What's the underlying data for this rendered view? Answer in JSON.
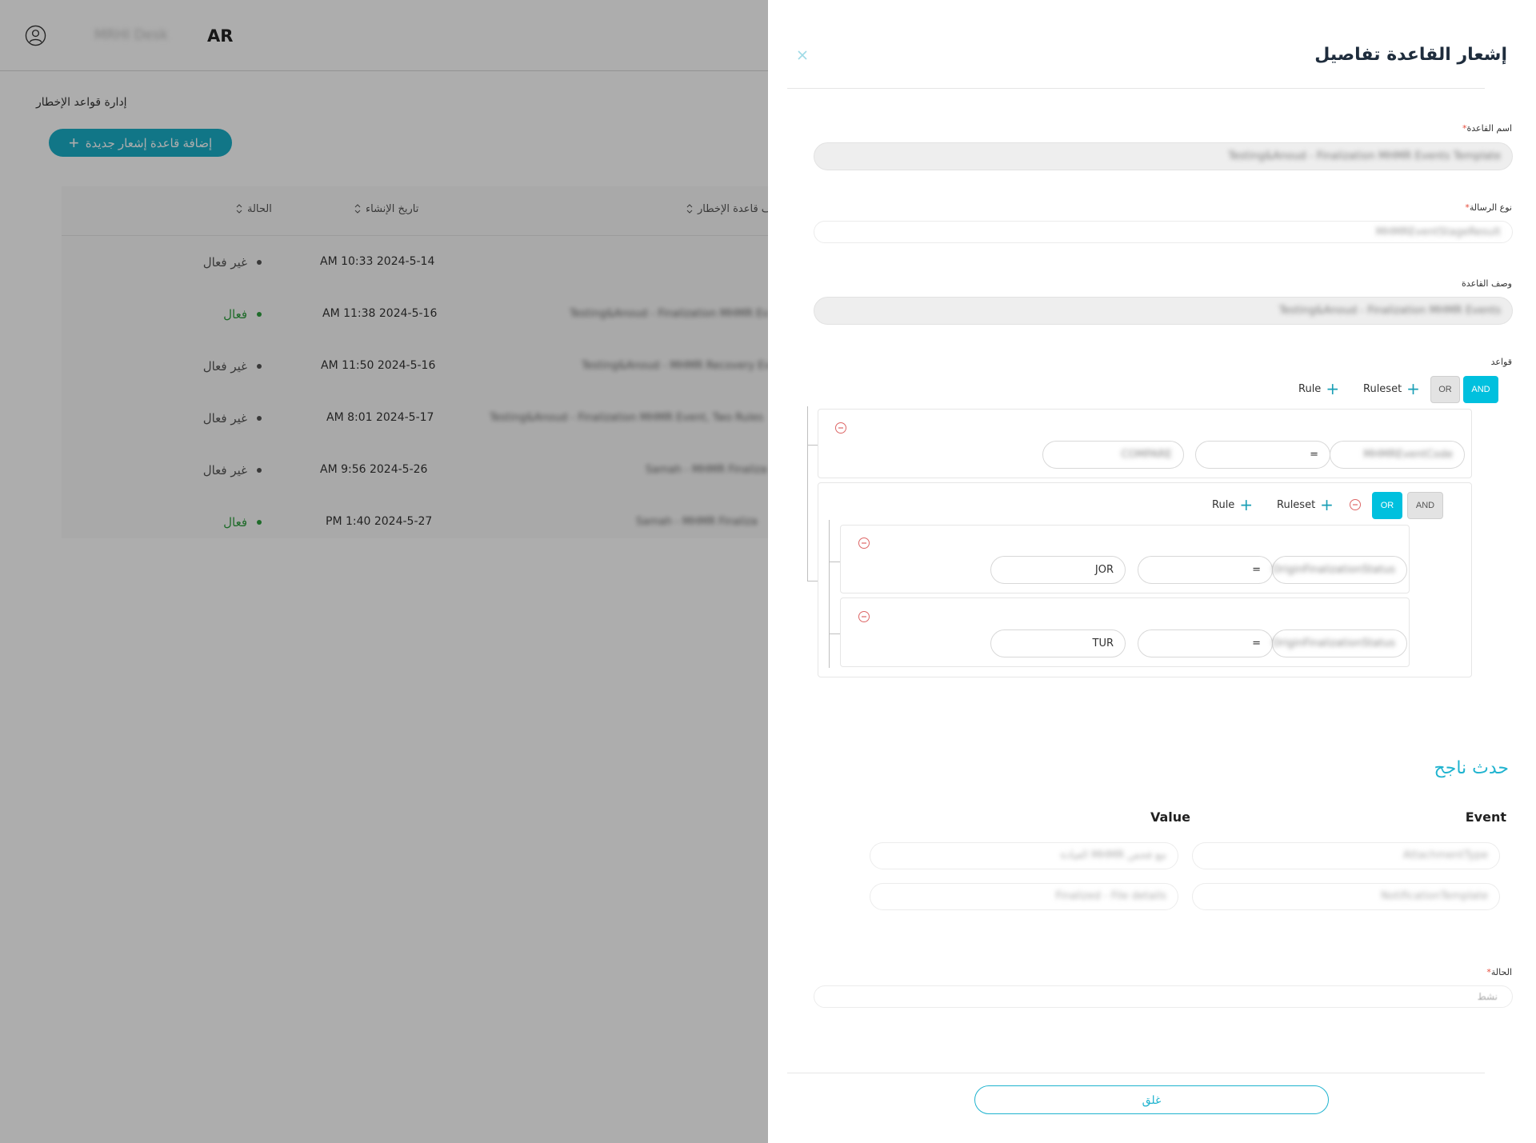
{
  "header": {
    "brand": "MRHI Desk",
    "language": "AR"
  },
  "page": {
    "title": "إدارة قواعد الإخطار",
    "add_button_label": "إضافة قاعدة إشعار جديدة",
    "table": {
      "columns": {
        "status": "الحالة",
        "created": "تاريخ الإنشاء",
        "name": "ف قاعدة الإخطار"
      },
      "rows": [
        {
          "status": "غير فعال",
          "active": false,
          "created": "AM 10:33 2024-5-14",
          "name": ""
        },
        {
          "status": "فعال",
          "active": true,
          "created": "AM 11:38 2024-5-16",
          "name": "Testing&Anoud - Finalization MHMR Ev"
        },
        {
          "status": "غير فعال",
          "active": false,
          "created": "AM 11:50 2024-5-16",
          "name": "Testing&Anoud - MHMR Recovery Ev"
        },
        {
          "status": "غير فعال",
          "active": false,
          "created": "AM 8:01 2024-5-17",
          "name": "Testing&Anoud - Finalization MHMR Event, Two Rules"
        },
        {
          "status": "غير فعال",
          "active": false,
          "created": "AM 9:56 2024-5-26",
          "name": "Samah - MHMR Finaliza"
        },
        {
          "status": "فعال",
          "active": true,
          "created": "PM 1:40 2024-5-27",
          "name": "Samah - MHMR Finaliza"
        }
      ]
    }
  },
  "drawer": {
    "title": "إشعار القاعدة تفاصيل",
    "rule_name": {
      "label": "اسم القاعدة",
      "value": "Testing&Anoud - Finalization MHMR Events Template"
    },
    "message_type": {
      "label": "نوع الرسالة",
      "value": "MHMREventStageResult"
    },
    "description": {
      "label": "وصف القاعدة",
      "value": "Testing&Anoud - Finalization MHMR Events"
    },
    "rules_label": "قواعد",
    "and_label": "AND",
    "or_label": "OR",
    "ruleset_label": "Ruleset",
    "rule_label": "Rule",
    "rule1": {
      "field": "MHMREventCode",
      "op": "=",
      "value": "COMPARE"
    },
    "rule2": {
      "field": "OriginFinalizationStatus",
      "op": "=",
      "value": "JOR"
    },
    "rule3": {
      "field": "OriginFinalizationStatus",
      "op": "=",
      "value": "TUR"
    },
    "resulting_event": {
      "title": "حدث ناجح",
      "col_event": "Event",
      "col_value": "Value",
      "rows": [
        {
          "event": "AttachmentType",
          "value": "العيادة MHMR مع فحص"
        },
        {
          "event": "NotificationTemplate",
          "value": "Finalized - File details"
        }
      ]
    },
    "status": {
      "label": "الحالة",
      "value": "نشط"
    },
    "close_label": "غلق"
  },
  "colors": {
    "accent": "#1fb3cf",
    "active_green": "#2e9e3f",
    "inactive_grey": "#555555"
  }
}
